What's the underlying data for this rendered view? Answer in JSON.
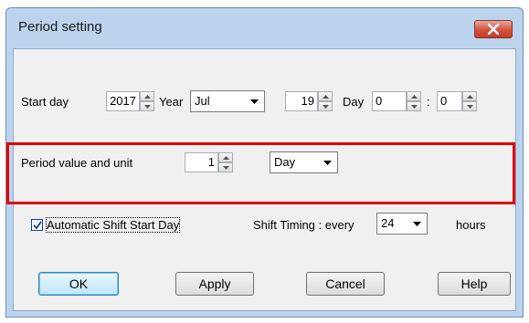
{
  "window": {
    "title": "Period setting"
  },
  "start": {
    "label": "Start day",
    "year_value": "2017",
    "year_unit": "Year",
    "month_value": "Jul",
    "day_value": "19",
    "day_unit": "Day",
    "hour_value": "0",
    "separator": ":",
    "minute_value": "0"
  },
  "period": {
    "label": "Period value and unit",
    "value": "1",
    "unit": "Day"
  },
  "shift": {
    "auto_label": "Automatic Shift Start Day",
    "auto_checked": true,
    "timing_label": "Shift Timing : every",
    "timing_value": "24",
    "timing_unit": "hours"
  },
  "buttons": {
    "ok": "OK",
    "apply": "Apply",
    "cancel": "Cancel",
    "help": "Help"
  },
  "colors": {
    "highlight": "#e00000",
    "close": "#c23d26"
  }
}
